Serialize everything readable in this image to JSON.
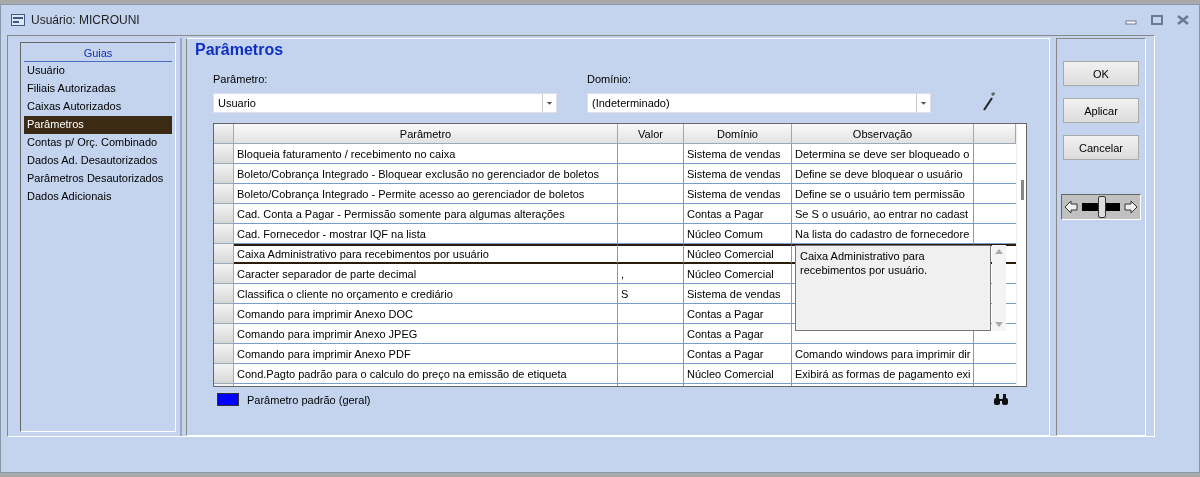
{
  "window": {
    "title": "Usuário: MICROUNI"
  },
  "sidebar": {
    "title": "Guias",
    "items": [
      {
        "label": "Usuário",
        "selected": false
      },
      {
        "label": "Filiais Autorizadas",
        "selected": false
      },
      {
        "label": "Caixas Autorizados",
        "selected": false
      },
      {
        "label": "Parâmetros",
        "selected": true
      },
      {
        "label": "Contas p/ Orç. Combinado",
        "selected": false
      },
      {
        "label": "Dados Ad. Desautorizados",
        "selected": false
      },
      {
        "label": "Parâmetros Desautorizados",
        "selected": false
      },
      {
        "label": "Dados Adicionais",
        "selected": false
      }
    ]
  },
  "heading": "Parâmetros",
  "filters": [
    {
      "label": "Parâmetro:",
      "value": "Usuario"
    },
    {
      "label": "Domínio:",
      "value": "(Indeterminado)"
    }
  ],
  "table": {
    "columns": [
      "Parâmetro",
      "Valor",
      "Domínio",
      "Observação"
    ],
    "rows": [
      {
        "parametro": "Bloqueia faturamento / recebimento no caixa",
        "valor": "",
        "dominio": "Sistema de vendas",
        "observacao": "Determina se deve ser bloqueado o",
        "selected": false
      },
      {
        "parametro": "Boleto/Cobrança Integrado - Bloquear exclusão no gerenciador de boletos",
        "valor": "",
        "dominio": "Sistema de vendas",
        "observacao": "Define se deve bloquear o usuário",
        "selected": false
      },
      {
        "parametro": "Boleto/Cobrança Integrado - Permite acesso ao gerenciador de boletos",
        "valor": "",
        "dominio": "Sistema de vendas",
        "observacao": "Define se o usuário tem permissão",
        "selected": false
      },
      {
        "parametro": "Cad. Conta a Pagar - Permissão somente para algumas alterações",
        "valor": "",
        "dominio": "Contas a Pagar",
        "observacao": "Se S o usuário, ao entrar no cadast",
        "selected": false
      },
      {
        "parametro": "Cad. Fornecedor - mostrar IQF na lista",
        "valor": "",
        "dominio": "Núcleo Comum",
        "observacao": "Na lista do cadastro de fornecedore",
        "selected": false
      },
      {
        "parametro": "Caixa Administrativo para recebimentos por usuário",
        "valor": "",
        "dominio": "Núcleo Comercial",
        "observacao": "",
        "selected": true
      },
      {
        "parametro": "Caracter separador de parte decimal",
        "valor": ",",
        "dominio": "Núcleo Comercial",
        "observacao": "",
        "selected": false
      },
      {
        "parametro": "Classifica o cliente no orçamento e crediário",
        "valor": "S",
        "dominio": "Sistema de vendas",
        "observacao": "",
        "selected": false
      },
      {
        "parametro": "Comando para imprimir Anexo DOC",
        "valor": "",
        "dominio": "Contas a Pagar",
        "observacao": "",
        "selected": false
      },
      {
        "parametro": "Comando para imprimir Anexo JPEG",
        "valor": "",
        "dominio": "Contas a Pagar",
        "observacao": "",
        "selected": false
      },
      {
        "parametro": "Comando para imprimir Anexo PDF",
        "valor": "",
        "dominio": "Contas a Pagar",
        "observacao": "Comando windows para imprimir dir",
        "selected": false
      },
      {
        "parametro": "Cond.Pagto padrão para o calculo do preço na emissão de etiqueta",
        "valor": "",
        "dominio": "Núcleo Comercial",
        "observacao": "Exibirá as formas de pagamento exi",
        "selected": false
      }
    ]
  },
  "memo": {
    "text": "Caixa Administrativo para recebimentos por usuário."
  },
  "legend": {
    "color": "#0000ff",
    "label": "Parâmetro padrão (geral)"
  },
  "buttons": [
    "OK",
    "Aplicar",
    "Cancelar"
  ],
  "slider": {
    "level": 0.5
  }
}
